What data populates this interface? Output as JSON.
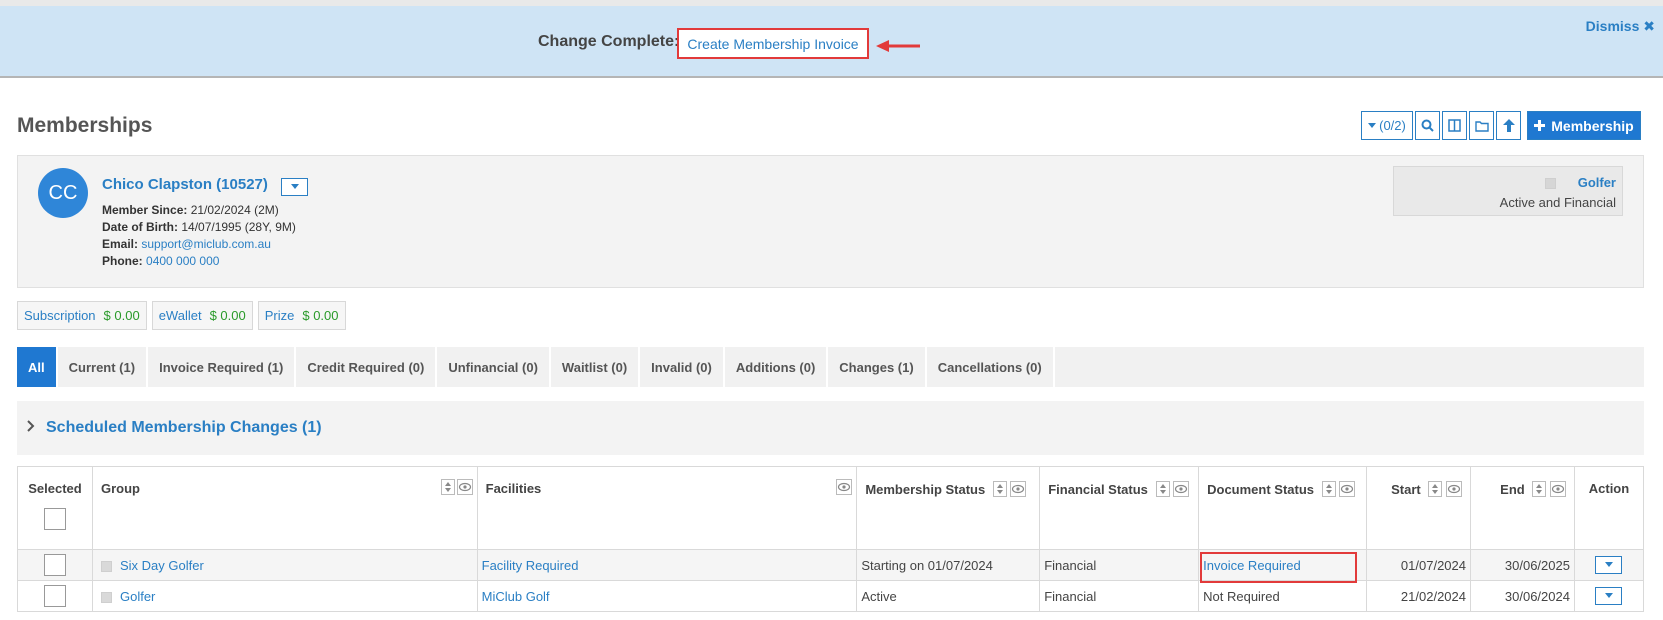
{
  "banner": {
    "label": "Change Complete:",
    "link": "Create Membership Invoice",
    "dismiss": "Dismiss ✖"
  },
  "page": {
    "title": "Memberships"
  },
  "toolbar": {
    "filter_count": "(0/2)",
    "add_label": "Membership"
  },
  "member": {
    "initials": "CC",
    "name": "Chico Clapston (10527)",
    "member_since_label": "Member Since:",
    "member_since": "21/02/2024 (2M)",
    "dob_label": "Date of Birth:",
    "dob": "14/07/1995 (28Y, 9M)",
    "email_label": "Email:",
    "email": "support@miclub.com.au",
    "phone_label": "Phone:",
    "phone": "0400 000 000",
    "status_group": "Golfer",
    "status_text": "Active and Financial"
  },
  "wallets": [
    {
      "label": "Subscription",
      "value": "$ 0.00"
    },
    {
      "label": "eWallet",
      "value": "$ 0.00"
    },
    {
      "label": "Prize",
      "value": "$ 0.00"
    }
  ],
  "tabs": [
    {
      "label": "All"
    },
    {
      "label": "Current (1)"
    },
    {
      "label": "Invoice Required (1)"
    },
    {
      "label": "Credit Required (0)"
    },
    {
      "label": "Unfinancial (0)"
    },
    {
      "label": "Waitlist (0)"
    },
    {
      "label": "Invalid (0)"
    },
    {
      "label": "Additions (0)"
    },
    {
      "label": "Changes (1)"
    },
    {
      "label": "Cancellations (0)"
    }
  ],
  "scheduled": {
    "label": "Scheduled Membership Changes (1)"
  },
  "table": {
    "headers": [
      "Selected",
      "Group",
      "Facilities",
      "Membership Status",
      "Financial Status",
      "Document Status",
      "Start",
      "End",
      "Action"
    ],
    "rows": [
      {
        "group": "Six Day Golfer",
        "facilities": "Facility Required",
        "membership_status": "Starting on 01/07/2024",
        "financial_status": "Financial",
        "document_status": "Invoice Required",
        "start": "01/07/2024",
        "end": "30/06/2025"
      },
      {
        "group": "Golfer",
        "facilities": "MiClub Golf",
        "membership_status": "Active",
        "financial_status": "Financial",
        "document_status": "Not Required",
        "start": "21/02/2024",
        "end": "30/06/2024"
      }
    ]
  },
  "colors": {
    "accent": "#1f78d1",
    "link": "#2a7fc4",
    "highlight": "#e23a3a",
    "banner_bg": "#cfe4f5",
    "money": "#2a9a2a"
  }
}
